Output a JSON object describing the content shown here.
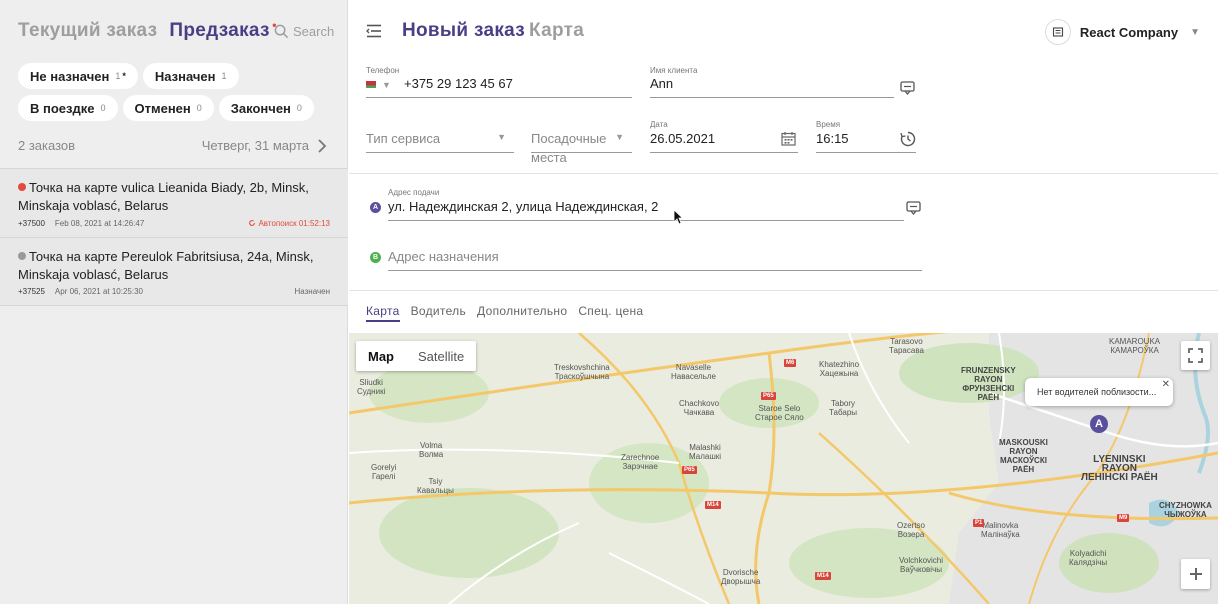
{
  "sidebar": {
    "tab_current": "Текущий заказ",
    "tab_preorder": "Предзаказ",
    "preorder_dot": "•",
    "search_label": "Search",
    "chips": [
      {
        "label": "Не назначен",
        "count": "1",
        "star": "*"
      },
      {
        "label": "Назначен",
        "count": "1"
      },
      {
        "label": "В поездке",
        "count": "0"
      },
      {
        "label": "Отменен",
        "count": "0"
      },
      {
        "label": "Закончен",
        "count": "0"
      }
    ],
    "orders_count": "2 заказов",
    "date_label": "Четверг, 31 марта",
    "orders": [
      {
        "address": "Точка на карте vulica Lieanida Biady, 2b, Minsk, Minskaja voblasć, Belarus",
        "phone": "+37500",
        "created": "Feb 08, 2021 at 14:26:47",
        "status": "Автопоиск 01:52:13",
        "pin_color": "#e24a3b",
        "status_color": "#e24a3b"
      },
      {
        "address": "Точка на карте Pereulok Fabritsiusa, 24a, Minsk, Minskaja voblasć, Belarus",
        "phone": "+37525",
        "created": "Apr 06, 2021 at 10:25:30",
        "status": "Назначен",
        "pin_color": "#999999",
        "status_color": "#666666"
      }
    ]
  },
  "header": {
    "title_new": "Новый заказ",
    "title_map": "Карта",
    "company": "React Company"
  },
  "form": {
    "phone_label": "Телефон",
    "phone_value": "+375 29 123 45 67",
    "client_label": "Имя клиента",
    "client_value": "Ann",
    "service_placeholder": "Тип сервиса",
    "seats_placeholder_1": "Посадочные",
    "seats_placeholder_2": "места",
    "date_label": "Дата",
    "date_value": "26.05.2021",
    "time_label": "Время",
    "time_value": "16:15",
    "pickup_label": "Адрес подачи",
    "pickup_value": "ул. Надеждинская 2, улица Надеждинская, 2",
    "pickup_marker": "A",
    "dest_placeholder": "Адрес назначения",
    "dest_marker": "B"
  },
  "subtabs": [
    "Карта",
    "Водитель",
    "Дополнительно",
    "Спец. цена"
  ],
  "map": {
    "type_map": "Map",
    "type_satellite": "Satellite",
    "tooltip": "Нет водителей поблизости...",
    "marker": "A",
    "labels": {
      "treskovshchina": "Treskovshchina\nТраскоўшчына",
      "navaselle": "Navaselle\nНавасельле",
      "tarasovo": "Tarasovo\nТарасава",
      "katezhino": "Khatezhino\nХацежына",
      "kamarouka": "KAMAROUKA\nКАМАРОЎКА",
      "siuhdki": "Sliudki\nСудникі",
      "chachkovo": "Chachkovo\nЧачкава",
      "staroe_selo": "Staroe Selo\nСтарое Сяло",
      "tabory": "Tabory\nТабары",
      "frunzensky": "FRUNZENSKY\nRAYON\nФРУНЗЕНСКІ\nРАЁН",
      "maskousky": "MASKOUSKI\nRAYON\nМАСКОЎСКІ\nРАЁН",
      "lyeninski": "LYENINSKI\nRAYON\nЛЕНІНСКІ РАЁН",
      "volma": "Volma\nВолма",
      "gorelyi": "Gorelyi\nГарелі",
      "zarechnoe": "Zarechnoe\nЗарэчнае",
      "malashki": "Malashki\nМалашкі",
      "tsiy": "Tsiy\nКавальцы",
      "ozertso": "Ozertso\nВозера",
      "malinovka": "Malinovka\nМалінаўка",
      "kolyadichi": "Kolyadichi\nКалядзічы",
      "volchkovichi": "Volchkovichi\nВаўчковічы",
      "dvorische": "Dvorische\nДворышча",
      "chyzhowka": "CHYZHOWKA\nЧЫЖОЎКА"
    },
    "shields": [
      "M6",
      "P65",
      "M14",
      "P65",
      "M14",
      "M9",
      "P1",
      "M9"
    ]
  },
  "colors": {
    "accent": "#4a3f86",
    "muted": "#9e9e9e",
    "alert": "#e24a3b",
    "pickup_dot": "#5a4f9c",
    "dest_dot": "#4caf50"
  }
}
